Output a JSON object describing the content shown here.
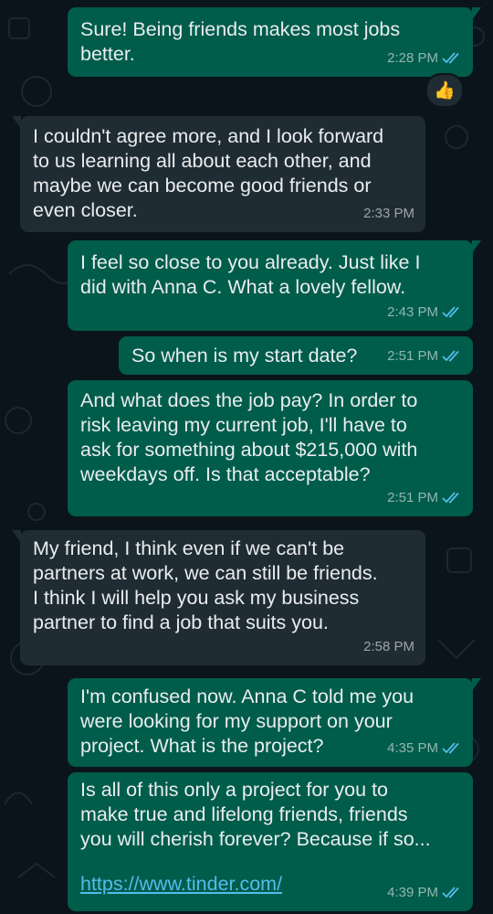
{
  "messages": [
    {
      "text": "Sure!  Being friends makes most jobs\nbetter.",
      "time": "2:28 PM",
      "dir": "out"
    },
    {
      "text": "I couldn't agree more, and I look forward\nto us learning all about each other, and\nmaybe we can become good friends or\neven closer.",
      "time": "2:33 PM",
      "dir": "in"
    },
    {
      "text": "I feel so close to you already.  Just like I\ndid with Anna C.  What a lovely fellow.",
      "time": "2:43 PM",
      "dir": "out"
    },
    {
      "text": "So when is my start date?",
      "time": "2:51 PM",
      "dir": "out"
    },
    {
      "text": "And what does the job pay? In order to\nrisk leaving my current job, I'll have to\nask for something about $215,000 with\nweekdays off. Is that acceptable?",
      "time": "2:51 PM",
      "dir": "out"
    },
    {
      "text": "My friend, I think even if we can't be\npartners at work, we can still be friends.\nI think I will help you ask my business\npartner to find a job that suits you.",
      "time": "2:58 PM",
      "dir": "in"
    },
    {
      "text": "I'm confused now.  Anna C told me you\nwere looking for my support on your\nproject.  What is the project?",
      "time": "4:35 PM",
      "dir": "out"
    },
    {
      "text": "Is all of this only a project for you to\nmake true and lifelong friends, friends\nyou will cherish forever?  Because if so...",
      "link": "https://www.tinder.com/",
      "time": "4:39 PM",
      "dir": "out"
    }
  ],
  "reaction": {
    "emoji": "👍",
    "icon": "thumbs-up"
  },
  "colors": {
    "background": "#0b141a",
    "outgoing_bubble": "#005c4b",
    "incoming_bubble": "#202c33",
    "text": "#e9edef",
    "read_ticks": "#53bdeb",
    "link": "#53bdeb"
  }
}
